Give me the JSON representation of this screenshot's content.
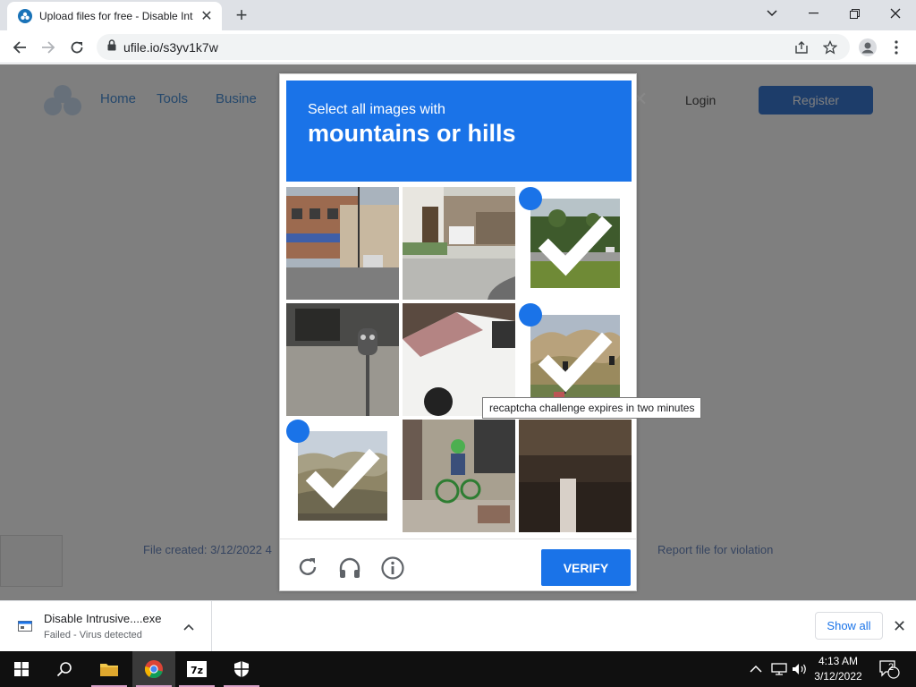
{
  "browser": {
    "tab_title": "Upload files for free - Disable Int",
    "new_tab": "+",
    "url": "ufile.io/s3yv1k7w"
  },
  "site": {
    "nav": [
      "Home",
      "Tools",
      "Busine"
    ],
    "login": "Login",
    "register": "Register",
    "footer_left": "File created: 3/12/2022 4",
    "footer_right": "Report file for violation"
  },
  "captcha": {
    "instruction": "Select all images with",
    "target": "mountains or hills",
    "verify_label": "VERIFY",
    "tooltip": "recaptcha challenge expires in two minutes",
    "tiles": [
      {
        "name": "street-storefronts",
        "selected": false
      },
      {
        "name": "house-driveway-car",
        "selected": false
      },
      {
        "name": "trees-road-field",
        "selected": true
      },
      {
        "name": "parking-meter",
        "selected": false
      },
      {
        "name": "white-car-closeup",
        "selected": false
      },
      {
        "name": "rocky-hill-traffic-light",
        "selected": true
      },
      {
        "name": "brown-hills",
        "selected": true
      },
      {
        "name": "kid-on-bicycle",
        "selected": false
      },
      {
        "name": "under-bridge",
        "selected": false
      }
    ],
    "accent_color": "#1a73e8"
  },
  "downloads": {
    "file_name": "Disable Intrusive....exe",
    "status": "Failed - Virus detected",
    "show_all": "Show all"
  },
  "taskbar": {
    "time": "4:13 AM",
    "date": "3/12/2022",
    "notification_count": "2"
  }
}
